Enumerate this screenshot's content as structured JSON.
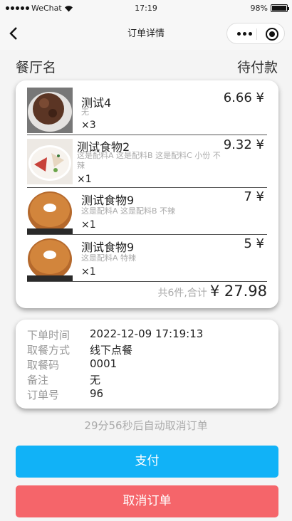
{
  "status_bar": {
    "carrier": "WeChat",
    "time": "17:19",
    "battery": "98%",
    "battery_level": 0.98
  },
  "nav": {
    "title": "订单详情"
  },
  "restaurant": {
    "name": "餐厅名",
    "status": "待付款"
  },
  "items": [
    {
      "name": "测试4",
      "spec": "无",
      "qty": "×3",
      "price": "6.66 ¥"
    },
    {
      "name": "测试食物2",
      "spec": "这是配料A 这是配料B 这是配料C 小份 不辣",
      "qty": "×1",
      "price": "9.32 ¥"
    },
    {
      "name": "测试食物9",
      "spec": "这是配料A 这是配料B 不辣",
      "qty": "×1",
      "price": "7 ¥"
    },
    {
      "name": "测试食物9",
      "spec": "这是配料A 特辣",
      "qty": "×1",
      "price": "5 ¥"
    }
  ],
  "summary": {
    "count": "共6件,合计",
    "total": "¥ 27.98"
  },
  "info": [
    {
      "label": "下单时间",
      "value": "2022-12-09 17:19:13"
    },
    {
      "label": "取餐方式",
      "value": "线下点餐"
    },
    {
      "label": "取餐码",
      "value": "0001"
    },
    {
      "label": "备注",
      "value": "无"
    },
    {
      "label": "订单号",
      "value": "96"
    }
  ],
  "countdown": "29分56秒后自动取消订单",
  "buttons": {
    "pay": "支付",
    "cancel": "取消订单"
  },
  "colors": {
    "pay": "#11b2f7",
    "cancel": "#f5656a",
    "background": "#f4f4f4"
  },
  "icons": {
    "back": "chevron-left-icon",
    "more": "more-dots-icon",
    "close": "record-circle-icon"
  }
}
